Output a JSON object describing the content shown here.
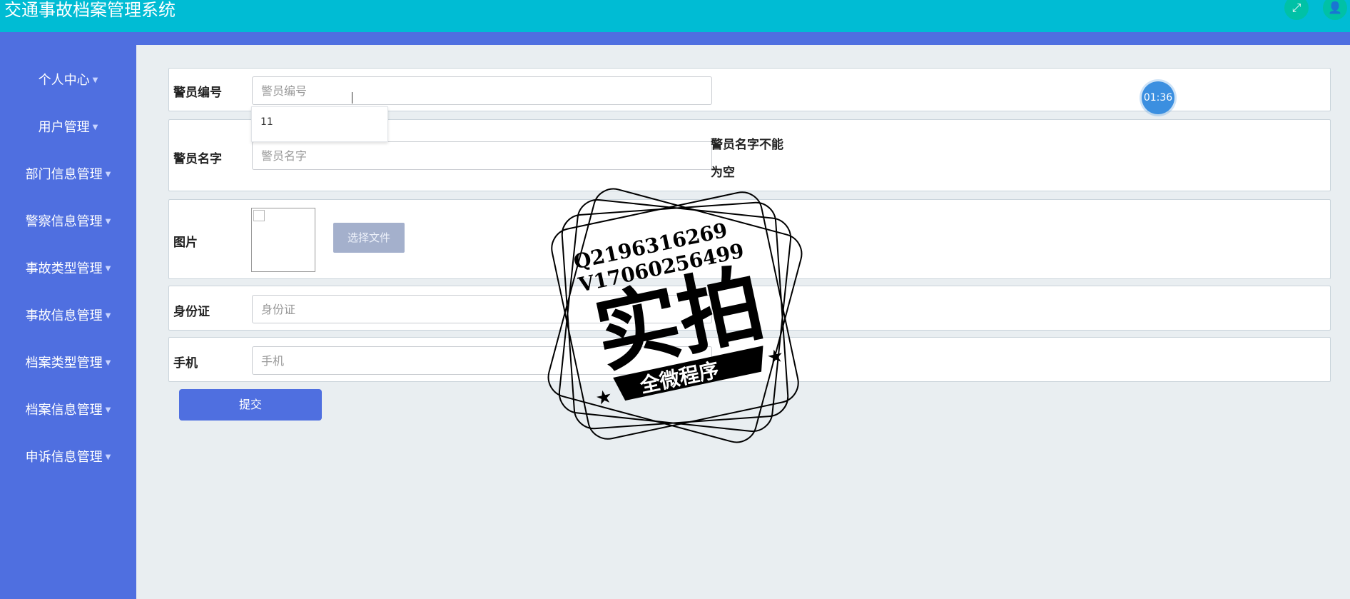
{
  "app": {
    "title": "交通事故档案管理系统"
  },
  "header": {
    "icons": [
      "fullscreen-icon",
      "user-icon"
    ]
  },
  "sidebar": {
    "items": [
      {
        "label": "个人中心"
      },
      {
        "label": "用户管理"
      },
      {
        "label": "部门信息管理"
      },
      {
        "label": "警察信息管理"
      },
      {
        "label": "事故类型管理"
      },
      {
        "label": "事故信息管理"
      },
      {
        "label": "档案类型管理"
      },
      {
        "label": "档案信息管理"
      },
      {
        "label": "申诉信息管理"
      }
    ]
  },
  "form": {
    "police_no": {
      "label": "警员编号",
      "placeholder": "警员编号",
      "value": ""
    },
    "autocomplete": {
      "options": [
        "11"
      ]
    },
    "police_name": {
      "label": "警员名字",
      "placeholder": "警员名字",
      "value": "",
      "error_line1": "警员名字不能",
      "error_line2": "为空"
    },
    "image": {
      "label": "图片",
      "button": "选择文件"
    },
    "id_card": {
      "label": "身份证",
      "placeholder": "身份证",
      "value": ""
    },
    "phone": {
      "label": "手机",
      "placeholder": "手机",
      "value": ""
    },
    "submit": "提交"
  },
  "timer": "01:36",
  "watermark": {
    "line1": "Q2196316269",
    "line2": "V17060256499",
    "big": "实拍",
    "banner": "全微程序"
  },
  "colors": {
    "topbar": "#00bcd4",
    "sidebar": "#4f6fe0",
    "button": "#4f6fe0",
    "background": "#e9eef1"
  }
}
